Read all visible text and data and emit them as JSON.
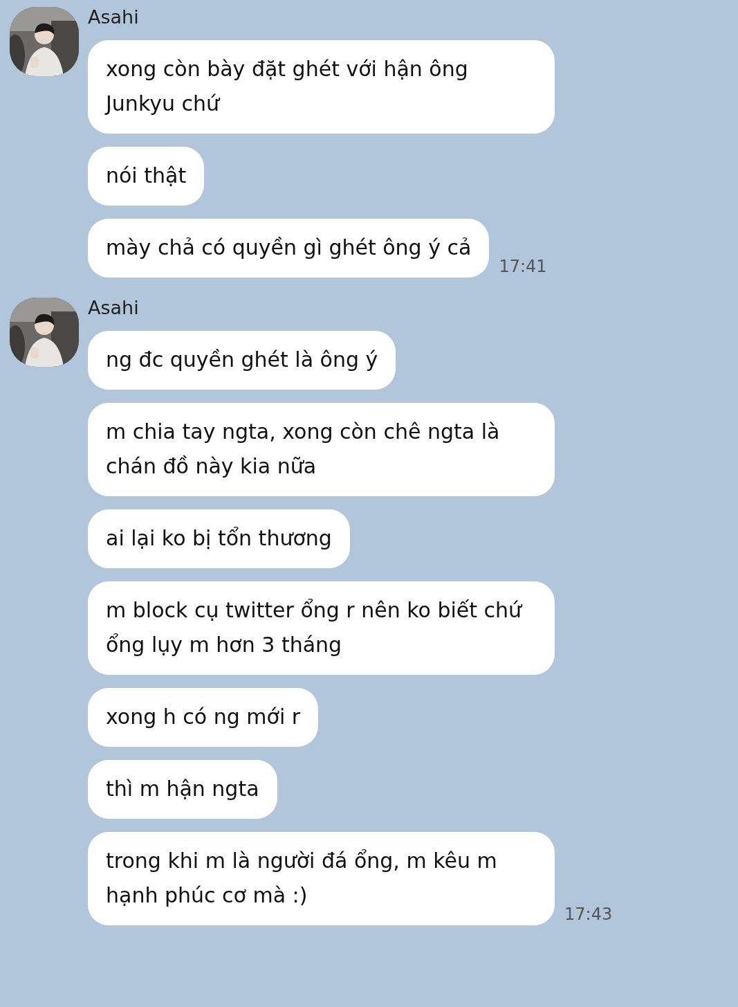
{
  "groups": [
    {
      "sender": "Asahi",
      "messages": [
        "xong còn bày đặt ghét với hận ông Junkyu chứ",
        "nói thật",
        "mày chả có quyền gì ghét ông ý cả"
      ],
      "time": "17:41"
    },
    {
      "sender": "Asahi",
      "messages": [
        "ng đc quyền ghét là ông ý",
        "m chia tay ngta, xong còn chê ngta là chán đồ này kia nữa",
        "ai lại ko bị tổn thương",
        "m block cụ twitter ổng r nên ko biết chứ ổng lụy m hơn 3 tháng",
        "xong h có ng mới r",
        "thì m hận ngta",
        "trong khi m là người đá ổng, m kêu m hạnh phúc cơ mà :)"
      ],
      "time": "17:43"
    }
  ]
}
